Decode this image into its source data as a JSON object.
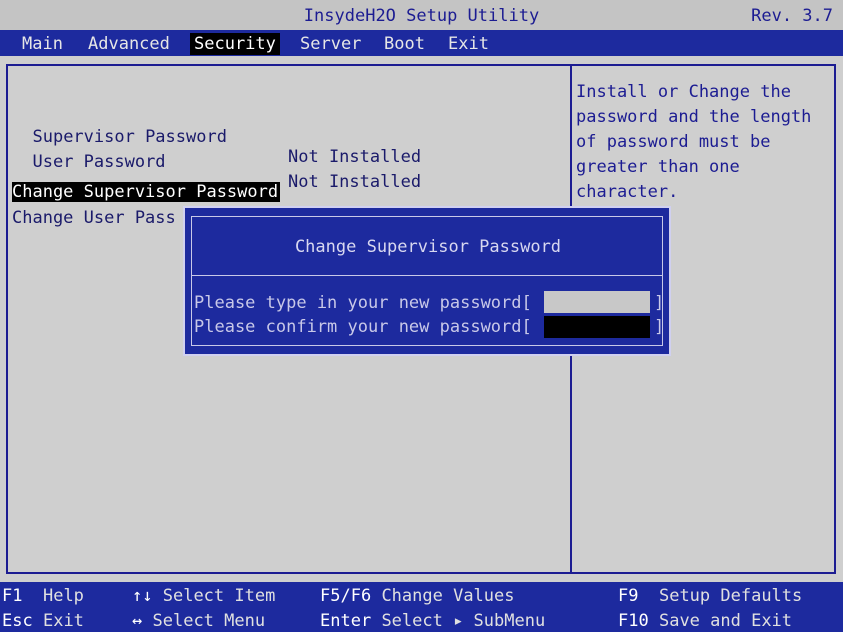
{
  "title": "InsydeH2O Setup Utility",
  "revision": "Rev. 3.7",
  "menu": [
    "Main",
    "Advanced",
    "Security",
    "Server",
    "Boot",
    "Exit"
  ],
  "active_menu": "Security",
  "settings": {
    "supervisor_password": {
      "label": "Supervisor Password",
      "value": "Not Installed"
    },
    "user_password": {
      "label": "User Password",
      "value": "Not Installed"
    },
    "change_supervisor": "Change Supervisor Password",
    "change_user": "Change User Pass"
  },
  "help": "Install or Change the password and the length of password must be greater than one character.",
  "dialog": {
    "title": "Change Supervisor Password",
    "line1": "Please type in your new password[",
    "line2": "Please confirm your new password[",
    "close_bracket": "]"
  },
  "footer": {
    "help_key": "F1",
    "help_label": "Help",
    "esc_key": "Esc",
    "esc_label": "Exit",
    "updown_key": "↑↓",
    "updown_label": "Select Item",
    "leftright_key": "↔",
    "leftright_label": "Select Menu",
    "f5f6_key": "F5/F6",
    "f5f6_label": "Change Values",
    "enter_key": "Enter",
    "enter_label": "Select ▸ SubMenu",
    "f9_key": "F9",
    "f9_label": "Setup Defaults",
    "f10_key": "F10",
    "f10_label": "Save and Exit"
  }
}
